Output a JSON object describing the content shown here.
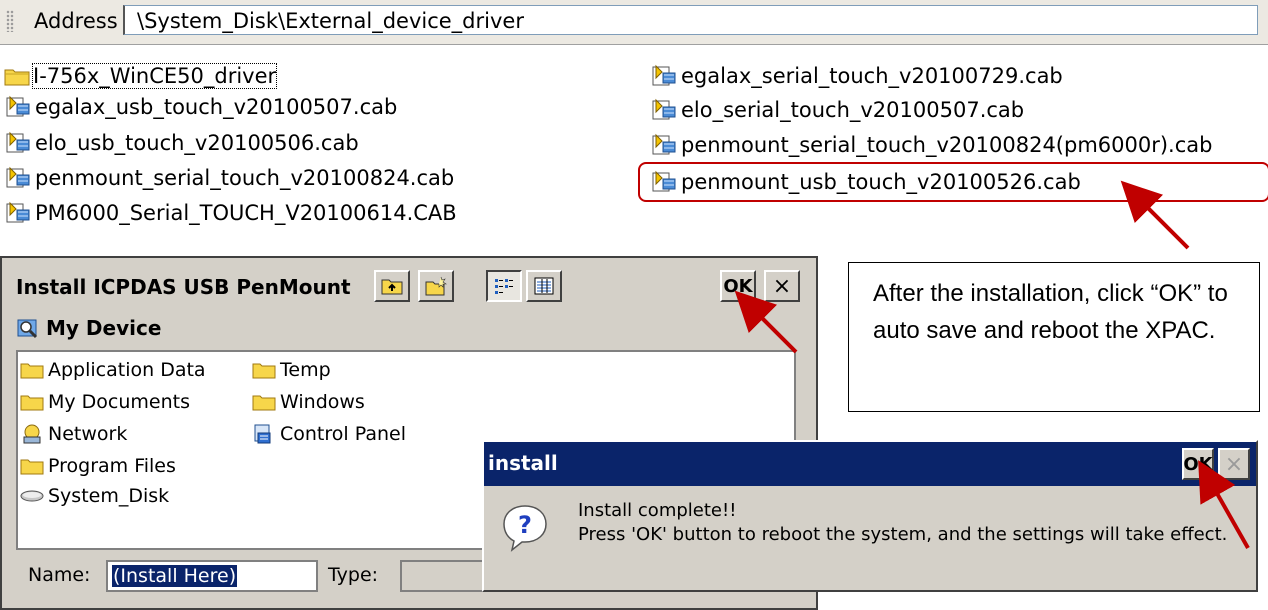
{
  "address_bar": {
    "label": "Address",
    "path": "\\System_Disk\\External_device_driver"
  },
  "files_left": [
    {
      "name": "I-756x_WinCE50_driver",
      "type": "folder"
    },
    {
      "name": "egalax_usb_touch_v20100507.cab",
      "type": "cab"
    },
    {
      "name": "elo_usb_touch_v20100506.cab",
      "type": "cab"
    },
    {
      "name": "penmount_serial_touch_v20100824.cab",
      "type": "cab"
    },
    {
      "name": "PM6000_Serial_TOUCH_V20100614.CAB",
      "type": "cab"
    }
  ],
  "files_right": [
    {
      "name": "egalax_serial_touch_v20100729.cab",
      "type": "cab"
    },
    {
      "name": "elo_serial_touch_v20100507.cab",
      "type": "cab"
    },
    {
      "name": "penmount_serial_touch_v20100824(pm6000r).cab",
      "type": "cab"
    },
    {
      "name": "penmount_usb_touch_v20100526.cab",
      "type": "cab",
      "highlighted": true
    }
  ],
  "install_window": {
    "title": "Install ICPDAS USB PenMount",
    "ok_label": "OK",
    "close_label": "×",
    "location": "My Device",
    "items": [
      {
        "name": "Application Data",
        "icon": "folder-icon"
      },
      {
        "name": "My Documents",
        "icon": "folder-icon"
      },
      {
        "name": "Network",
        "icon": "network-icon"
      },
      {
        "name": "Program Files",
        "icon": "folder-icon"
      },
      {
        "name": "System_Disk",
        "icon": "disk-icon"
      },
      {
        "name": "Temp",
        "icon": "folder-icon"
      },
      {
        "name": "Windows",
        "icon": "folder-icon"
      },
      {
        "name": "Control Panel",
        "icon": "control-panel-icon"
      }
    ],
    "name_label": "Name:",
    "name_value": "(Install Here)",
    "type_label": "Type:"
  },
  "callout": {
    "text": "After the installation, click “OK” to auto save and reboot the XPAC."
  },
  "msgbox": {
    "title": "install",
    "ok_label": "OK",
    "close_label": "×",
    "line1": "Install complete!!",
    "line2": "Press 'OK' button to reboot the system, and the settings will take effect."
  },
  "colors": {
    "annotation_red": "#c00000",
    "titlebar_blue": "#0a246a",
    "window_gray": "#d4d0c8"
  }
}
